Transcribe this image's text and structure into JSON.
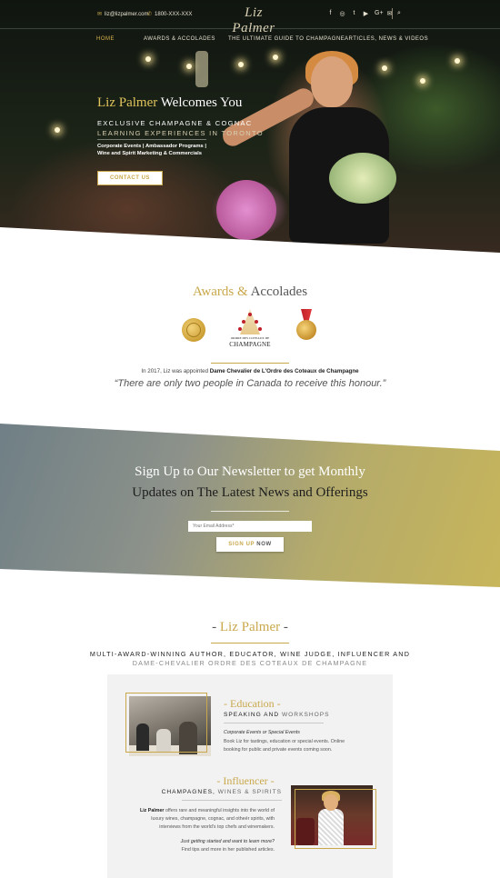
{
  "header": {
    "email": "liz@lizpalmer.com",
    "phone": "1800-XXX-XXX",
    "logo_text": "Liz Palmer",
    "social_icons": [
      "facebook-icon",
      "instagram-icon",
      "twitter-icon",
      "youtube-icon",
      "google-plus-icon",
      "mail-icon"
    ],
    "social_glyphs": [
      "f",
      "◎",
      "t",
      "▶",
      "G+",
      "✉"
    ],
    "search_glyph": "⌕",
    "nav": [
      {
        "label": "HOME",
        "active": true
      },
      {
        "label": "AWARDS & ACCOLADES",
        "active": false
      },
      {
        "label": "THE ULTIMATE GUIDE TO CHAMPAGNE",
        "active": false
      },
      {
        "label": "ARTICLES, NEWS & VIDEOS",
        "active": false
      }
    ]
  },
  "hero": {
    "title_highlight": "Liz Palmer",
    "title_rest": "Welcomes You",
    "subtitle_line1": "EXCLUSIVE CHAMPAGNE & COGNAC",
    "subtitle_line2": "LEARNING EXPERIENCES IN TORONTO",
    "services_line1": "Corporate Events | Ambassador Programs |",
    "services_line2": "Wine and Spirit Marketing & Commercials",
    "cta_label": "CONTACT US"
  },
  "awards": {
    "title_gold": "Awards &",
    "title_rest": "Accolades",
    "ordre_small": "ORDRE DES COTEAUX DE",
    "ordre_big": "CHAMPAGNE",
    "appointment_prefix": "In 2017, Liz was appointed",
    "appointment_bold": "Dame Chevalier de L'Ordre des Coteaux de Champagne",
    "quote": "“There are only two people in Canada to receive this honour.”"
  },
  "newsletter": {
    "title_line1": "Sign Up to Our Newsletter to get Monthly",
    "title_line2": "Updates on The Latest News and Offerings",
    "email_placeholder": "Your Email Address*",
    "button_gold": "SIGN UP",
    "button_dark": "NOW"
  },
  "about": {
    "title_dash_left": "- ",
    "title_name": "Liz Palmer",
    "title_dash_right": " -",
    "tagline1": "MULTI-AWARD-WINNING AUTHOR, EDUCATOR, WINE JUDGE, INFLUENCER AND",
    "tagline2": "DAME-CHEVALIER ORDRE DES COTEAUX DE CHAMPAGNE"
  },
  "education": {
    "title": "- Education -",
    "sub_bold": "SPEAKING AND",
    "sub_light": "WORKSHOPS",
    "italic": "Corporate Events or Special Events",
    "body": "Book Liz for tastings, education or special events. Online booking for public and private events coming soon."
  },
  "influencer": {
    "title": "- Influencer -",
    "sub_bold": "CHAMPAGNES,",
    "sub_light": "WINES & SPIRITS",
    "body_bold": "Liz Palmer",
    "body_rest": "offers rare and meaningful insights into the world of luxury wines, champagne, cognac, and otheér spirits, with interviews from the world's top chefs and winemakers.",
    "italic": "Just getting started and want to learn more?",
    "link_text": "Find tips and more in her published articles."
  }
}
